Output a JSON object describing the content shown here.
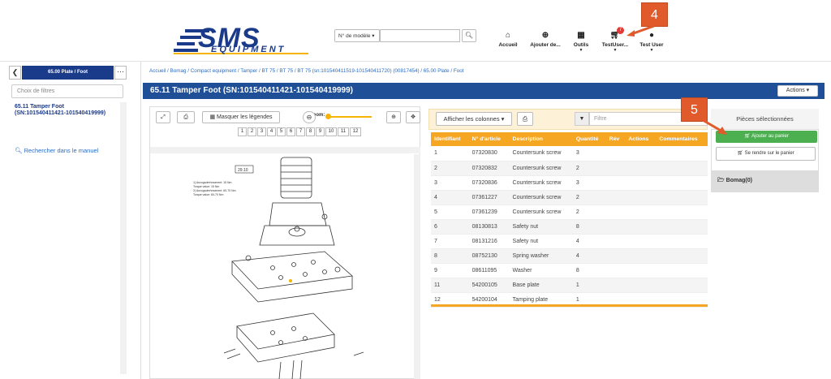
{
  "header": {
    "logo_main": "SMS",
    "logo_sub": "EQUIPMENT",
    "model_select": "N° de modèle ▾",
    "search_icon": "search-icon",
    "nav": [
      {
        "label": "Accueil",
        "icon": "home-icon"
      },
      {
        "label": "Ajouter de...",
        "icon": "plus-circle-icon"
      },
      {
        "label": "Outils",
        "icon": "briefcase-icon"
      },
      {
        "label": "TestUser...",
        "icon": "cart-icon"
      },
      {
        "label": "Test User",
        "icon": "user-icon"
      }
    ],
    "cart_badge": "7"
  },
  "callouts": {
    "c4": "4",
    "c5": "5"
  },
  "sidebar": {
    "title": "65.00 Plate / Foot",
    "filter_placeholder": "Choix de filtres",
    "node_label": "65.11 Tamper Foot (SN:101540411421-101540419999)",
    "search_link": "Rechercher dans le manuel"
  },
  "breadcrumb": "Accueil / Bomag / Compact equipment / Tamper / BT 75 / BT 75 / BT 75 (sn:101540411519-101540411720) (00817454) / 65.00 Plate / Foot",
  "page_title": "65.11 Tamper Foot (SN:101540411421-101540419999)",
  "actions_label": "Actions ▾",
  "viewer": {
    "hide_legends": "Masquer les légendes",
    "zoom_label": "Zoom:",
    "pages": [
      "1",
      "2",
      "3",
      "4",
      "5",
      "6",
      "7",
      "8",
      "9",
      "10",
      "11",
      "12"
    ],
    "diagram_ref": "29.10",
    "diagram_notes": [
      "1) Anzugsdrehmoment: 15 Nm",
      "Torque value: 15 Nm",
      "2) Anzugsdrehmoment: 60-70 Nm",
      "Torque value: 60-70 Nm"
    ]
  },
  "table": {
    "show_columns": "Afficher les colonnes ▾",
    "filter_placeholder": "Filtre",
    "headers": [
      "Identifiant",
      "N° d'article",
      "Description",
      "Quantité",
      "Rév",
      "Actions",
      "Commentaires"
    ],
    "rows": [
      [
        "1",
        "07320830",
        "Countersunk screw",
        "3"
      ],
      [
        "2",
        "07320832",
        "Countersunk screw",
        "2"
      ],
      [
        "3",
        "07320836",
        "Countersunk screw",
        "3"
      ],
      [
        "4",
        "07361227",
        "Countersunk screw",
        "2"
      ],
      [
        "5",
        "07361239",
        "Countersunk screw",
        "2"
      ],
      [
        "6",
        "08130813",
        "Safety nut",
        "8"
      ],
      [
        "7",
        "08131216",
        "Safety nut",
        "4"
      ],
      [
        "8",
        "08752130",
        "Spring washer",
        "4"
      ],
      [
        "9",
        "08611095",
        "Washer",
        "8"
      ],
      [
        "11",
        "54200105",
        "Base plate",
        "1"
      ],
      [
        "12",
        "54200104",
        "Tamping plate",
        "1"
      ]
    ]
  },
  "selected": {
    "header": "Pièces sélectionnées",
    "add_to_cart": "Ajouter au panier",
    "go_to_cart": "Se rendre sur le panier",
    "group": "Bomag(0)"
  }
}
